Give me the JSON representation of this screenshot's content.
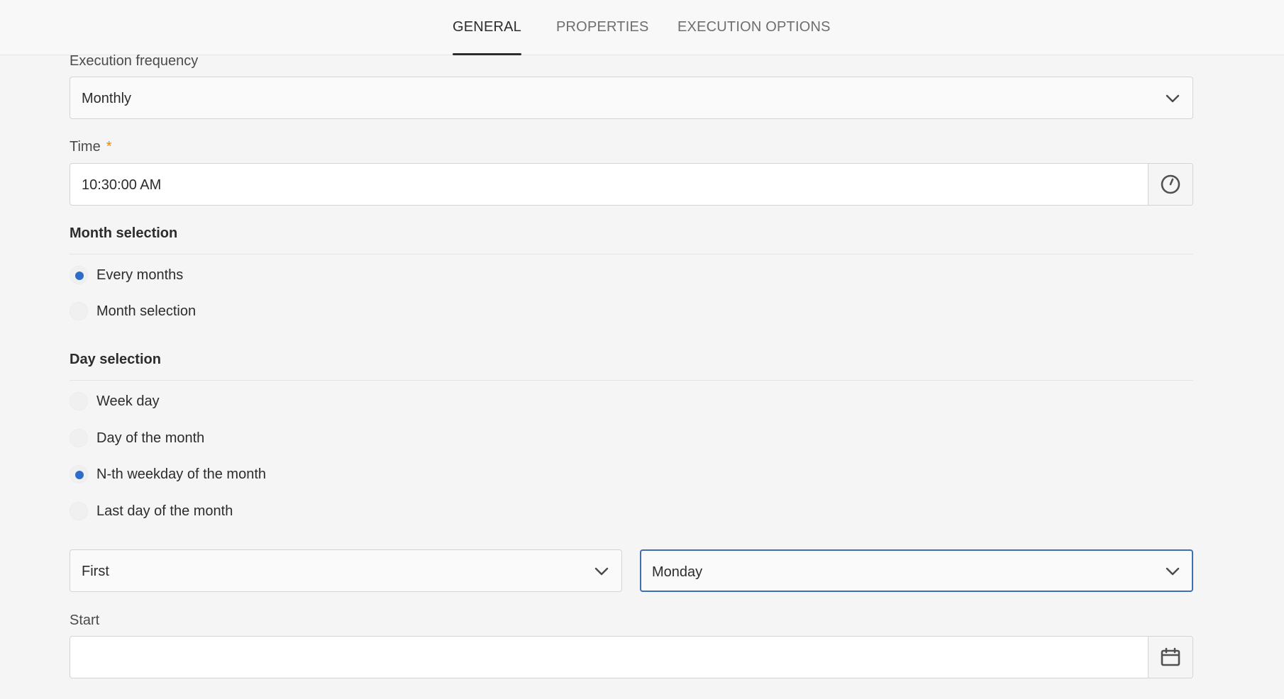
{
  "tabs": [
    {
      "label": "GENERAL",
      "active": true
    },
    {
      "label": "PROPERTIES",
      "active": false
    },
    {
      "label": "EXECUTION OPTIONS",
      "active": false
    }
  ],
  "frequency": {
    "label": "Execution frequency",
    "value": "Monthly"
  },
  "time": {
    "label": "Time",
    "required_mark": "*",
    "value": "10:30:00 AM",
    "icon": "clock-icon"
  },
  "month_selection": {
    "title": "Month selection",
    "options": [
      {
        "label": "Every months",
        "checked": true
      },
      {
        "label": "Month selection",
        "checked": false
      }
    ]
  },
  "day_selection": {
    "title": "Day selection",
    "options": [
      {
        "label": "Week day",
        "checked": false
      },
      {
        "label": "Day of the month",
        "checked": false
      },
      {
        "label": "N-th weekday of the month",
        "checked": true
      },
      {
        "label": "Last day of the month",
        "checked": false
      }
    ]
  },
  "nth_select": {
    "value": "First"
  },
  "weekday_select": {
    "value": "Monday"
  },
  "start": {
    "label": "Start",
    "value": "",
    "icon": "calendar-icon"
  },
  "colors": {
    "accent": "#2d6cc8",
    "required": "#e68619",
    "focus_border": "#3d6fb4"
  }
}
